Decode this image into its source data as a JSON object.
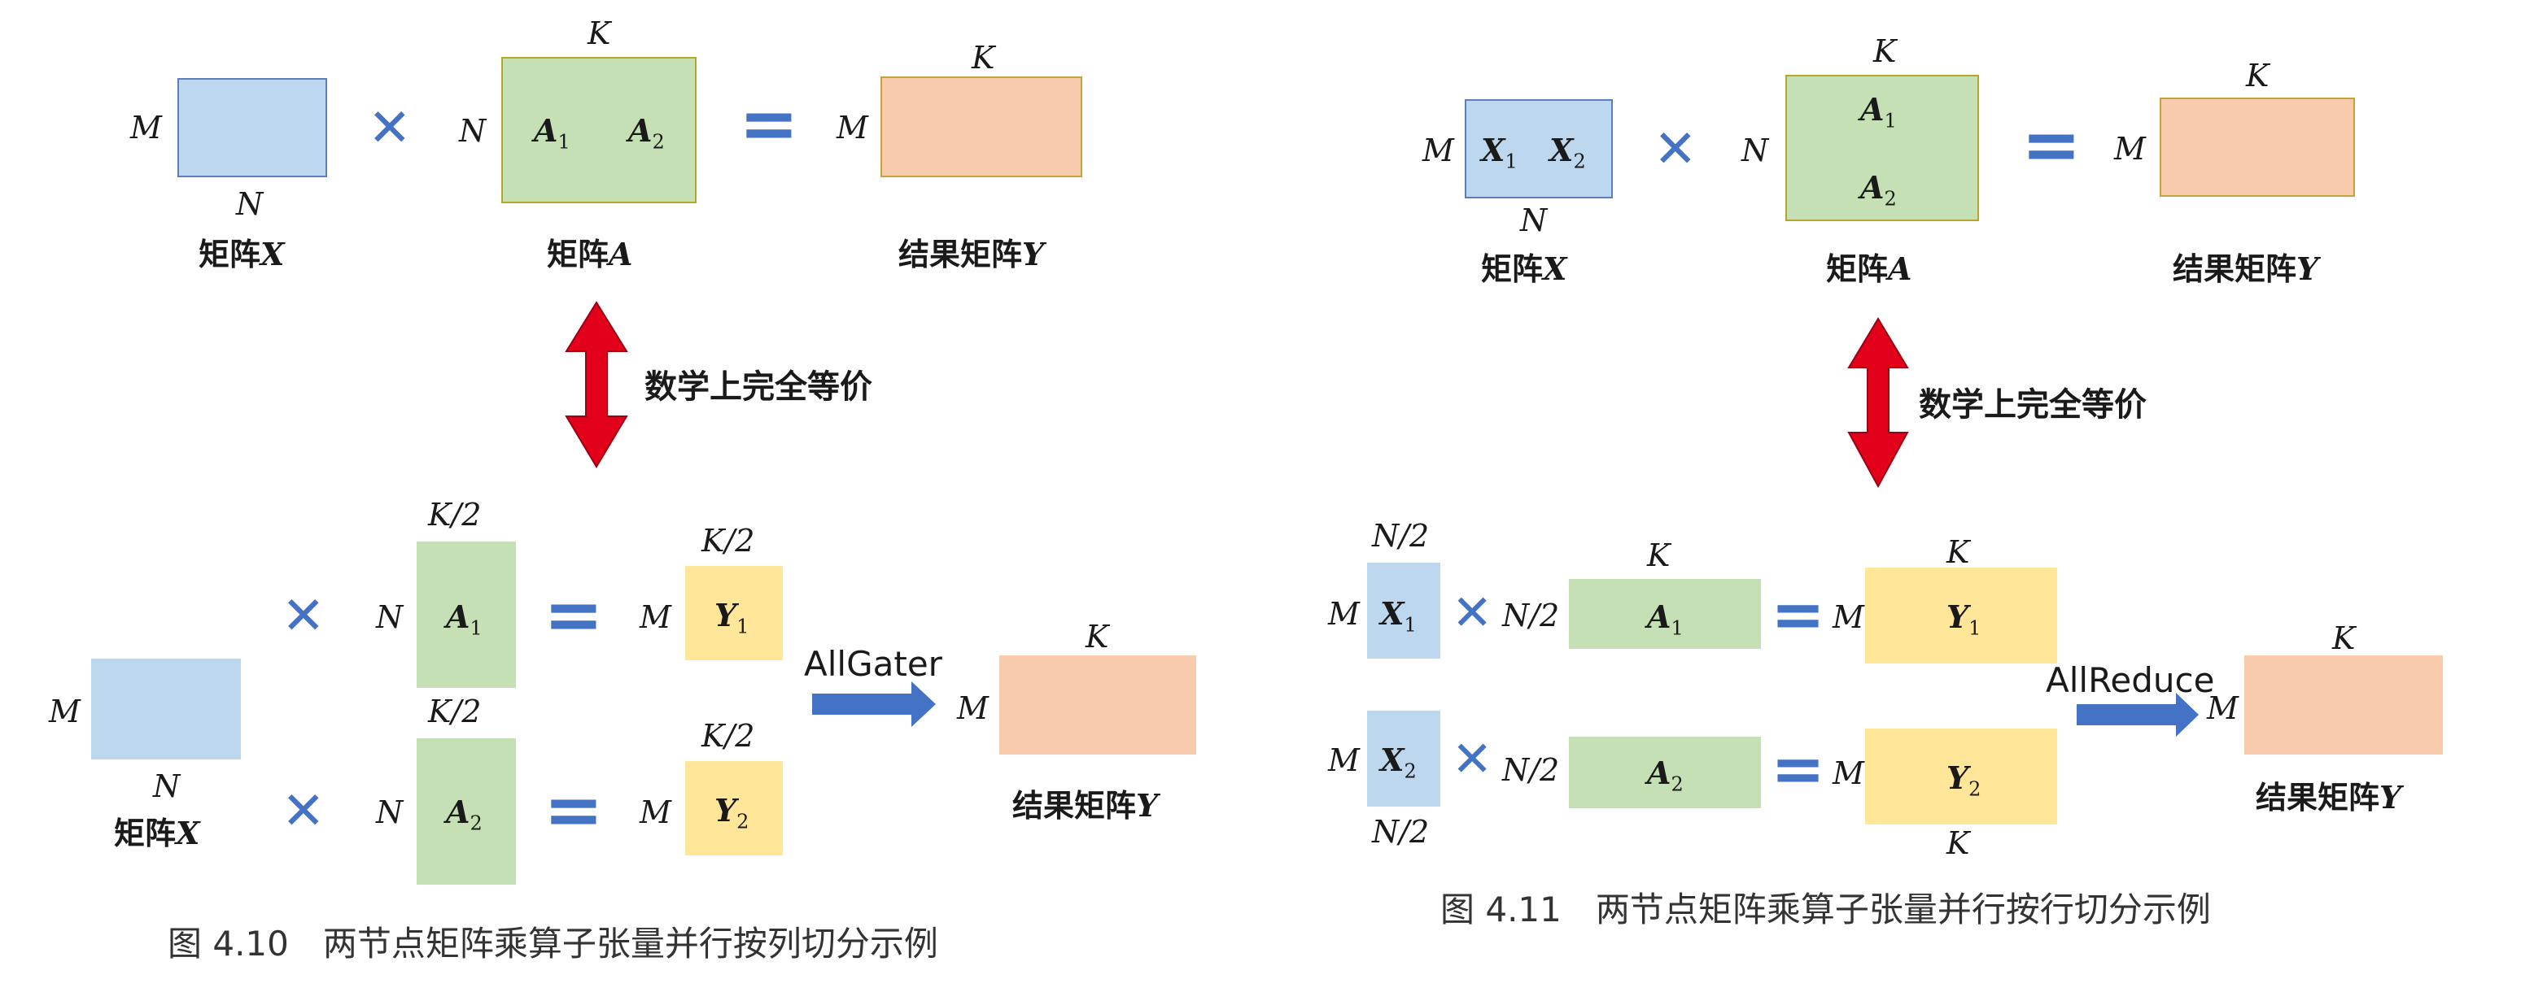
{
  "labels": {
    "M": "M",
    "N": "N",
    "K": "K",
    "K2": "K/2",
    "N2": "N/2"
  },
  "matrices": {
    "A1": "A",
    "A2": "A",
    "X1": "X",
    "X2": "X",
    "Y1": "Y",
    "Y2": "Y",
    "sub1": "1",
    "sub2": "2"
  },
  "captions": {
    "matrix_x_prefix": "矩阵",
    "matrix_x_var": "X",
    "matrix_a_prefix": "矩阵",
    "matrix_a_var": "A",
    "result_prefix": "结果矩阵",
    "result_var": "Y"
  },
  "equivalence_text": "数学上完全等价",
  "operators": {
    "times": "✕",
    "equals": "="
  },
  "left": {
    "collective_label": "AllGater",
    "figure_caption": "图 4.10　两节点矩阵乘算子张量并行按列切分示例"
  },
  "right": {
    "collective_label": "AllReduce",
    "figure_caption": "图 4.11　两节点矩阵乘算子张量并行按行切分示例"
  },
  "colors": {
    "blue": "#bdd7ee",
    "green": "#c5e0b4",
    "orange": "#f8cbad",
    "yellow": "#ffe699",
    "arrow_red": "#e3001b",
    "operator_blue": "#4472c4"
  }
}
